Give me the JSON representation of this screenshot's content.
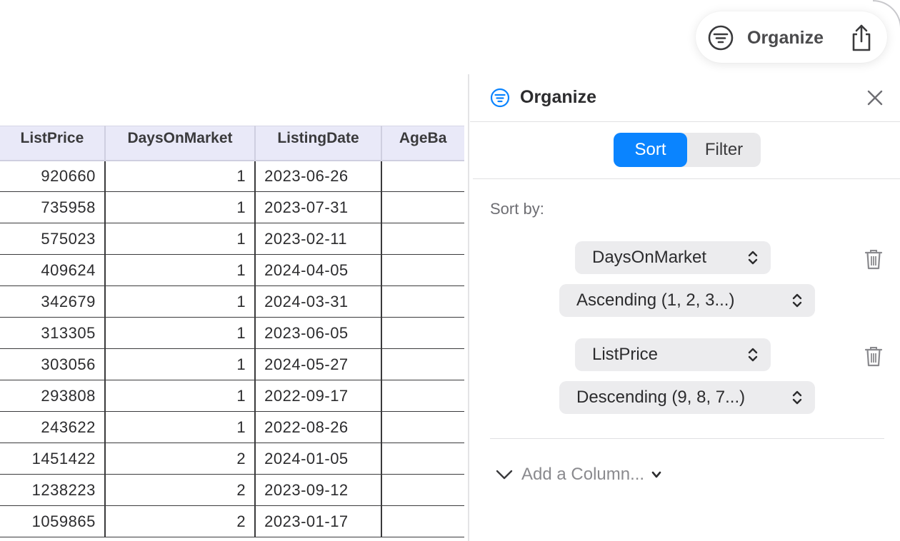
{
  "toolbar": {
    "organize_label": "Organize",
    "filter_icon": "filter-lines-icon",
    "share_icon": "share-icon"
  },
  "table": {
    "columns": [
      "ListPrice",
      "DaysOnMarket",
      "ListingDate",
      "AgeBa"
    ],
    "rows": [
      [
        "920660",
        "1",
        "2023-06-26",
        ""
      ],
      [
        "735958",
        "1",
        "2023-07-31",
        ""
      ],
      [
        "575023",
        "1",
        "2023-02-11",
        ""
      ],
      [
        "409624",
        "1",
        "2024-04-05",
        ""
      ],
      [
        "342679",
        "1",
        "2024-03-31",
        ""
      ],
      [
        "313305",
        "1",
        "2023-06-05",
        ""
      ],
      [
        "303056",
        "1",
        "2024-05-27",
        ""
      ],
      [
        "293808",
        "1",
        "2022-09-17",
        ""
      ],
      [
        "243622",
        "1",
        "2022-08-26",
        ""
      ],
      [
        "1451422",
        "2",
        "2024-01-05",
        ""
      ],
      [
        "1238223",
        "2",
        "2023-09-12",
        ""
      ],
      [
        "1059865",
        "2",
        "2023-01-17",
        ""
      ]
    ]
  },
  "panel": {
    "title": "Organize",
    "tabs": {
      "sort": "Sort",
      "filter": "Filter",
      "active": "Sort"
    },
    "sort_by_label": "Sort by:",
    "sort_rules": [
      {
        "column": "DaysOnMarket",
        "order": "Ascending (1, 2, 3...)"
      },
      {
        "column": "ListPrice",
        "order": "Descending (9, 8, 7...)"
      }
    ],
    "add_column_label": "Add a Column...",
    "accent_color": "#0a84ff"
  }
}
